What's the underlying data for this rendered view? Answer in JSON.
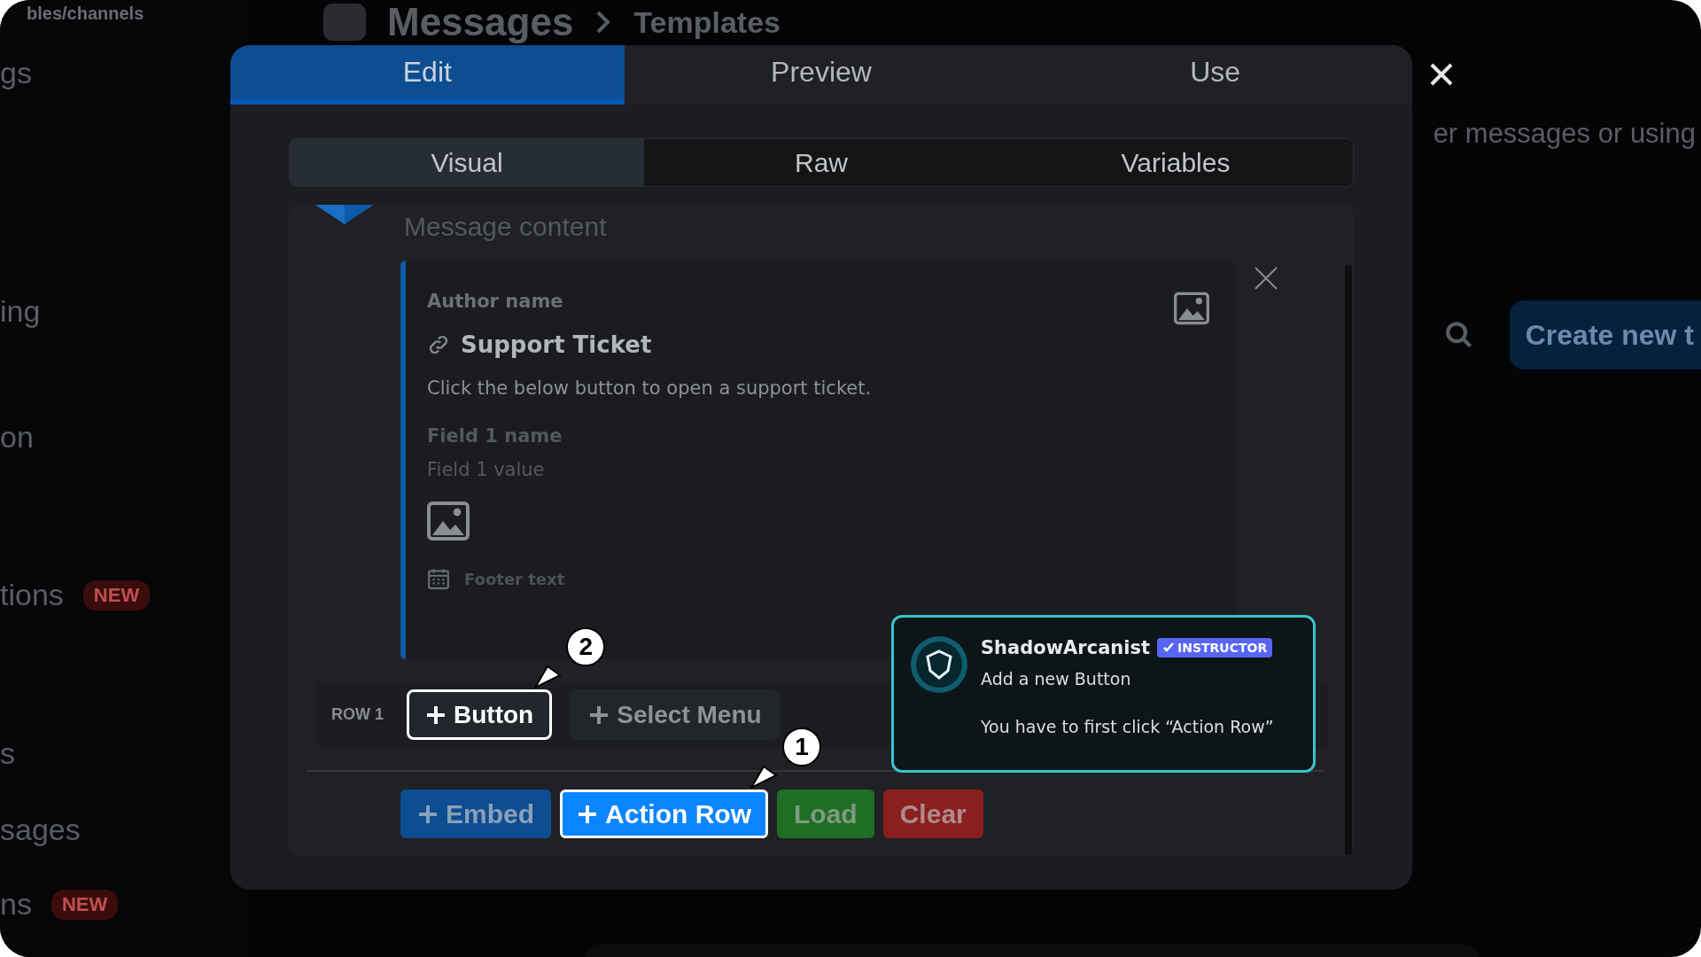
{
  "background": {
    "breadcrumb_fragment": "bles/channels",
    "sidebar": {
      "items": [
        {
          "label": "gs"
        },
        {
          "label": "ing"
        },
        {
          "label": "on"
        },
        {
          "label": "tions",
          "badge": "NEW"
        },
        {
          "label": "s"
        },
        {
          "label": "sages"
        },
        {
          "label": "ns",
          "badge": "NEW"
        }
      ]
    },
    "header": {
      "title": "Messages",
      "subtitle": "Templates"
    },
    "description": "er messages or using",
    "create_button": "Create new t"
  },
  "dialog": {
    "tabs": [
      {
        "label": "Edit",
        "selected": true
      },
      {
        "label": "Preview",
        "selected": false
      },
      {
        "label": "Use",
        "selected": false
      }
    ],
    "subtabs": [
      {
        "label": "Visual",
        "selected": true
      },
      {
        "label": "Raw",
        "selected": false
      },
      {
        "label": "Variables",
        "selected": false
      }
    ],
    "message_placeholder": "Message content",
    "embed": {
      "author": "Author name",
      "title": "Support Ticket",
      "description": "Click the below button to open a support ticket.",
      "fields": [
        {
          "name": "Field 1 name",
          "value": "Field 1 value"
        }
      ],
      "footer": "Footer text"
    },
    "action_rows": [
      {
        "label": "ROW 1",
        "buttons": [
          {
            "label": "Button",
            "highlighted": true,
            "step": "2"
          },
          {
            "label": "Select Menu",
            "highlighted": false
          }
        ]
      }
    ],
    "buttons": [
      {
        "label": "Embed",
        "kind": "embed",
        "highlighted": false
      },
      {
        "label": "Action Row",
        "kind": "action_row",
        "highlighted": true,
        "step": "1"
      },
      {
        "label": "Load",
        "kind": "load",
        "highlighted": false
      },
      {
        "label": "Clear",
        "kind": "clear",
        "highlighted": false
      }
    ]
  },
  "tooltip": {
    "author": "ShadowArcanist",
    "badge": "INSTRUCTOR",
    "title": "Add a new Button",
    "body": "You have to first click “Action Row”"
  }
}
